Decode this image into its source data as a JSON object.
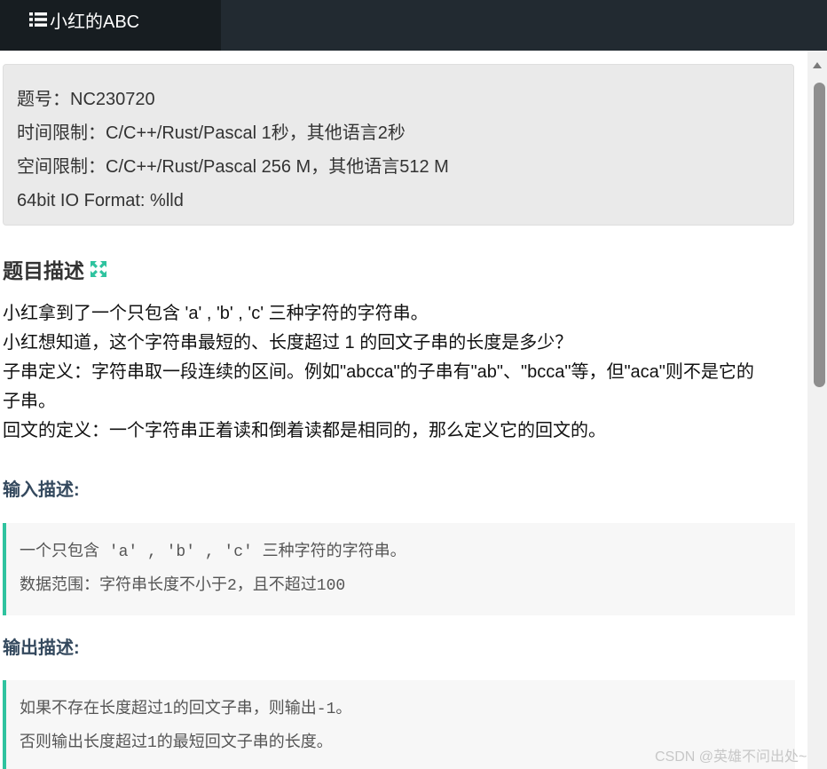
{
  "header": {
    "tab_title": "小红的ABC",
    "tab_icon": "list-icon"
  },
  "info": {
    "problem_id": "题号：NC230720",
    "time_limit": "时间限制：C/C++/Rust/Pascal 1秒，其他语言2秒",
    "space_limit": "空间限制：C/C++/Rust/Pascal 256 M，其他语言512 M",
    "io_format": "64bit IO Format: %lld"
  },
  "description": {
    "title": "题目描述",
    "expand_icon": "expand-icon",
    "expand_icon_color": "#2fc39f",
    "paragraphs": [
      "小红拿到了一个只包含 'a' , 'b' , 'c' 三种字符的字符串。",
      "小红想知道，这个字符串最短的、长度超过 1 的回文子串的长度是多少？",
      "子串定义：字符串取一段连续的区间。例如\"abcca\"的子串有\"ab\"、\"bcca\"等，但\"aca\"则不是它的",
      "子串。",
      "回文的定义：一个字符串正着读和倒着读都是相同的，那么定义它的回文的。"
    ]
  },
  "input": {
    "title": "输入描述:",
    "lines": [
      "一个只包含 'a' , 'b' , 'c' 三种字符的字符串。",
      "数据范围：字符串长度不小于2，且不超过100"
    ]
  },
  "output": {
    "title": "输出描述:",
    "lines": [
      "如果不存在长度超过1的回文子串，则输出-1。",
      "否则输出长度超过1的最短回文子串的长度。"
    ]
  },
  "watermark": "CSDN @英雄不问出处~",
  "colors": {
    "header_bg": "#222a31",
    "tab_bg": "#171d21",
    "accent": "#2fc39f",
    "subtitle": "#34495e"
  }
}
